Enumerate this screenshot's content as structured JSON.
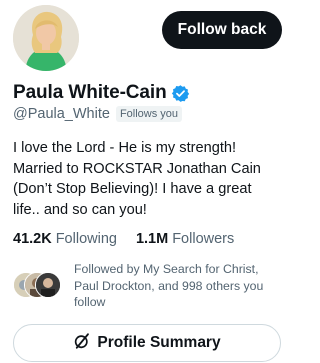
{
  "profile": {
    "name": "Paula White-Cain",
    "handle": "@Paula_White",
    "follows_you": "Follows you",
    "bio": "I love the Lord - He is my strength!\nMarried to ROCKSTAR Jonathan Cain\n(Don’t Stop Believing)! I have a great\nlife.. and so can you!",
    "verified_icon": "verified-badge-icon",
    "verified_color": "#1d9bf0"
  },
  "actions": {
    "follow_back_label": "Follow back",
    "profile_summary_label": "Profile Summary",
    "profile_summary_icon": "grok-slash-icon"
  },
  "stats": {
    "following_count": "41.2K",
    "following_label": "Following",
    "followers_count": "1.1M",
    "followers_label": "Followers"
  },
  "followed_by": {
    "text": "Followed by My Search for Christ, Paul Drockton, and 998 others you follow"
  }
}
